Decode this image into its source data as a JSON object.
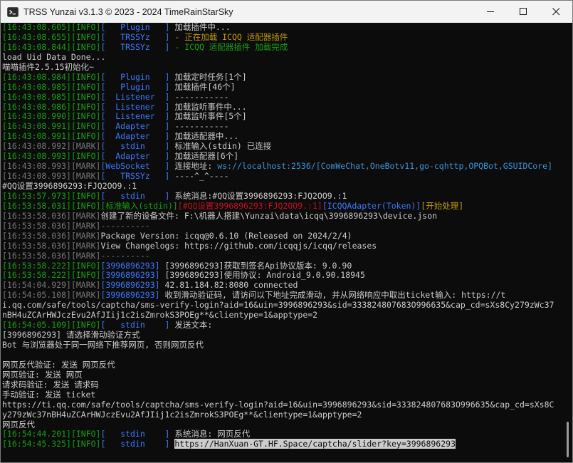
{
  "window": {
    "title": "TRSS Yunzai v3.1.3 © 2023 - 2024 TimeRainStarSky",
    "icon": "terminal-icon",
    "controls": [
      "minimize-icon",
      "maximize-icon",
      "close-icon"
    ]
  },
  "colors": {
    "green": "#13a10e",
    "blue": "#3b78ff",
    "yellow": "#c19c00",
    "red": "#c50f1f",
    "gray": "#767676",
    "white": "#cccccc",
    "magenta": "#b4009e",
    "cyan": "#3a96dd"
  },
  "terminal": {
    "lines": [
      [
        [
          "g",
          "[16:43:08.605]"
        ],
        [
          "g",
          "[INFO]"
        ],
        [
          "b",
          "[   Plugin   ]"
        ],
        [
          "w",
          " 加载插件中..."
        ]
      ],
      [
        [
          "g",
          "[16:43:08.655]"
        ],
        [
          "g",
          "[INFO]"
        ],
        [
          "b",
          "[   TRSSYz   ]"
        ],
        [
          "y",
          " - 正在加载 ICQQ 适配器插件"
        ]
      ],
      [
        [
          "g",
          "[16:43:08.844]"
        ],
        [
          "g",
          "[INFO]"
        ],
        [
          "b",
          "[   TRSSYz   ]"
        ],
        [
          "g",
          " - ICQQ 适配器插件 加载完成"
        ]
      ],
      [
        [
          "w",
          "load Uid Data Done..."
        ]
      ],
      [
        [
          "w",
          "喵喵插件2.5.15初始化~"
        ]
      ],
      [
        [
          "g",
          "[16:43:08.984]"
        ],
        [
          "g",
          "[INFO]"
        ],
        [
          "b",
          "[   Plugin   ]"
        ],
        [
          "w",
          " 加载定时任务[1个]"
        ]
      ],
      [
        [
          "g",
          "[16:43:08.985]"
        ],
        [
          "g",
          "[INFO]"
        ],
        [
          "b",
          "[   Plugin   ]"
        ],
        [
          "w",
          " 加载插件[46个]"
        ]
      ],
      [
        [
          "g",
          "[16:43:08.985]"
        ],
        [
          "g",
          "[INFO]"
        ],
        [
          "b",
          "[  Listener  ]"
        ],
        [
          "w",
          " -----------"
        ]
      ],
      [
        [
          "g",
          "[16:43:08.986]"
        ],
        [
          "g",
          "[INFO]"
        ],
        [
          "b",
          "[  Listener  ]"
        ],
        [
          "w",
          " 加载监听事件中..."
        ]
      ],
      [
        [
          "g",
          "[16:43:08.990]"
        ],
        [
          "g",
          "[INFO]"
        ],
        [
          "b",
          "[  Listener  ]"
        ],
        [
          "w",
          " 加载监听事件[5个]"
        ]
      ],
      [
        [
          "g",
          "[16:43:08.991]"
        ],
        [
          "g",
          "[INFO]"
        ],
        [
          "b",
          "[  Adapter   ]"
        ],
        [
          "w",
          " -----------"
        ]
      ],
      [
        [
          "g",
          "[16:43:08.991]"
        ],
        [
          "g",
          "[INFO]"
        ],
        [
          "b",
          "[  Adapter   ]"
        ],
        [
          "w",
          " 加载适配器中..."
        ]
      ],
      [
        [
          "x",
          "[16:43:08.992]"
        ],
        [
          "x",
          "[MARK]"
        ],
        [
          "b",
          "[   stdin    ]"
        ],
        [
          "w",
          " 标准输入(stdin) 已连接"
        ]
      ],
      [
        [
          "g",
          "[16:43:08.993]"
        ],
        [
          "g",
          "[INFO]"
        ],
        [
          "b",
          "[  Adapter   ]"
        ],
        [
          "w",
          " 加载适配器[6个]"
        ]
      ],
      [
        [
          "x",
          "[16:43:08.993]"
        ],
        [
          "x",
          "[MARK]"
        ],
        [
          "b",
          "[WebSocket   ]"
        ],
        [
          "w",
          " 连接地址: "
        ],
        [
          "c",
          "ws://localhost:2536/"
        ],
        [
          "c",
          "[ComWeChat,OneBotv11,go-cqhttp,OPQBot,GSUIDCore]"
        ]
      ],
      [
        [
          "x",
          "[16:43:08.993]"
        ],
        [
          "x",
          "[MARK]"
        ],
        [
          "b",
          "[   TRSSYz   ]"
        ],
        [
          "w",
          " ----^_^----"
        ]
      ],
      [
        [
          "w",
          "#QQ设置3996896293:FJQ2OO9.:1"
        ]
      ],
      [
        [
          "g",
          "[16:53:57.973]"
        ],
        [
          "g",
          "[INFO]"
        ],
        [
          "b",
          "[   stdin    ]"
        ],
        [
          "w",
          " 系统消息:#QQ设置3996896293:FJQ2OO9.:1"
        ]
      ],
      [
        [
          "g",
          "[16:53:58.031]"
        ],
        [
          "g",
          "[INFO]"
        ],
        [
          "g",
          "[标准输入(stdin)]"
        ],
        [
          "r",
          "[#QQ设置3996896293:FJQ2OO9.:1]"
        ],
        [
          "b",
          "[ICQQAdapter(Token)]"
        ],
        [
          "y",
          "[开始处理]"
        ]
      ],
      [
        [
          "x",
          "[16:53:58.036]"
        ],
        [
          "x",
          "[MARK]"
        ],
        [
          "w",
          "创建了新的设备文件: F:\\机器人搭建\\Yunzai\\data\\icqq\\3996896293\\device.json"
        ]
      ],
      [
        [
          "x",
          "[16:53:58.036]"
        ],
        [
          "x",
          "[MARK]"
        ],
        [
          "x",
          "----------"
        ]
      ],
      [
        [
          "x",
          "[16:53:58.036]"
        ],
        [
          "x",
          "[MARK]"
        ],
        [
          "w",
          "Package Version: icqq@0.6.10 (Released on 2024/2/4)"
        ]
      ],
      [
        [
          "x",
          "[16:53:58.036]"
        ],
        [
          "x",
          "[MARK]"
        ],
        [
          "w",
          "View Changelogs: https://github.com/icqqjs/icqq/releases"
        ]
      ],
      [
        [
          "x",
          "[16:53:58.036]"
        ],
        [
          "x",
          "[MARK]"
        ],
        [
          "x",
          "----------"
        ]
      ],
      [
        [
          "g",
          "[16:53:58.222]"
        ],
        [
          "g",
          "[INFO]"
        ],
        [
          "b",
          "[3996896293]"
        ],
        [
          "w",
          " [3996896293]获取到签名Api协议版本: 9.0.90"
        ]
      ],
      [
        [
          "g",
          "[16:53:58.222]"
        ],
        [
          "g",
          "[INFO]"
        ],
        [
          "b",
          "[3996896293]"
        ],
        [
          "w",
          " [3996896293]使用协议: Android_9.0.90.18945"
        ]
      ],
      [
        [
          "x",
          "[16:54:04.929]"
        ],
        [
          "x",
          "[MARK]"
        ],
        [
          "b",
          "[3996896293]"
        ],
        [
          "w",
          " 42.81.184.82:8080 connected"
        ]
      ],
      [
        [
          "x",
          "[16:54:05.108]"
        ],
        [
          "x",
          "[MARK]"
        ],
        [
          "b",
          "[3996896293]"
        ],
        [
          "w",
          " 收到滑动验证码, 请访问以下地址完成滑动, 并从网络响应中取出ticket输入: https://t"
        ]
      ],
      [
        [
          "w",
          "i.qq.com/safe/tools/captcha/sms-verify-login?aid=16&uin=3996896293&sid=333824807683O996635&cap_cd=sXs8Cy279zWc37"
        ]
      ],
      [
        [
          "w",
          "nBH4uZCArHWJczEvu2AfJIij1c2isZmrokS3POEg**&clientype=1&apptype=2"
        ]
      ],
      [
        [
          "g",
          "[16:54:05.109]"
        ],
        [
          "g",
          "[INFO]"
        ],
        [
          "b",
          "[   stdin    ]"
        ],
        [
          "w",
          " 发送文本:"
        ]
      ],
      [
        [
          "w",
          "[3996896293] 请选择滑动验证方式"
        ]
      ],
      [
        [
          "w",
          "Bot 与浏览器处于同一网络下推荐网页, 否则网页反代"
        ]
      ],
      [
        [
          "w",
          ""
        ]
      ],
      [
        [
          "w",
          "网页反代验证: 发送 网页反代"
        ]
      ],
      [
        [
          "w",
          "网页验证: 发送 网页"
        ]
      ],
      [
        [
          "w",
          "请求码验证: 发送 请求码"
        ]
      ],
      [
        [
          "w",
          "手动验证: 发送 ticket"
        ]
      ],
      [
        [
          "w",
          "https://ti.qq.com/safe/tools/captcha/sms-verify-login?aid=16&uin=3996896293&sid=333824807683O996635&cap_cd=sXs8C"
        ]
      ],
      [
        [
          "w",
          "y279zWc37nBH4uZCArHWJczEvu2AfJIij1c2isZmrokS3POEg**&clientype=1&apptype=2"
        ]
      ],
      [
        [
          "w",
          "网页反代"
        ]
      ],
      [
        [
          "g",
          "[16:54:44.201]"
        ],
        [
          "g",
          "[INFO]"
        ],
        [
          "b",
          "[   stdin    ]"
        ],
        [
          "w",
          " 系统消息: 网页反代"
        ]
      ],
      [
        [
          "g",
          "[16:54:45.325]"
        ],
        [
          "g",
          "[INFO]"
        ],
        [
          "b",
          "[   stdin    ]"
        ],
        [
          "w",
          " "
        ],
        [
          "h",
          "https://HanXuan-GT.HF.Space/captcha/slider?key=3996896293"
        ]
      ]
    ]
  }
}
